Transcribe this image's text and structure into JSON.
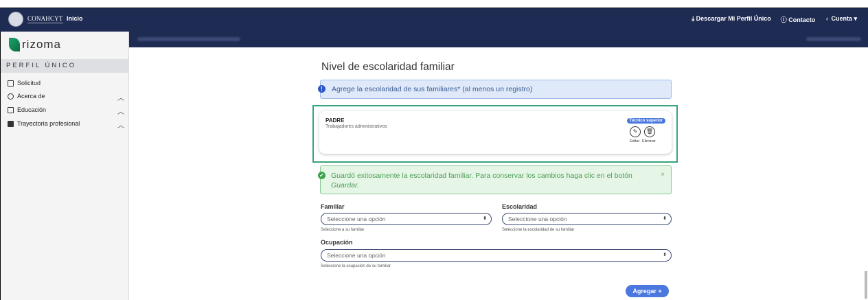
{
  "topbar": {
    "brand": "CONAHCYT",
    "inicio": "Inicio",
    "download": "⤓ Descargar Mi Perfil Único",
    "contact": "ⓘ Contacto",
    "account": "♁ Cuenta ▾"
  },
  "sidebar": {
    "logo_text": "rizoma",
    "section_title": "PERFIL ÚNICO",
    "items": [
      {
        "label": "Solicitud",
        "chevron": ""
      },
      {
        "label": "Acerca de",
        "chevron": "︿"
      },
      {
        "label": "Educación",
        "chevron": "︿"
      },
      {
        "label": "Trayectoria profesional",
        "chevron": "︿"
      }
    ]
  },
  "main": {
    "title": "Nivel de escolaridad familiar",
    "info_icon": "!",
    "info_text": "Agrege la escolaridad de sus familiares* (al menos un registro)",
    "card": {
      "relation": "PADRE",
      "occupation": "Trabajadores administrativos",
      "badge": "Técnico superior",
      "edit_icon": "✎",
      "delete_icon": "🗑",
      "edit_label": "Editar",
      "delete_label": "Eliminar"
    },
    "success": {
      "icon": "✔",
      "text": "Guardó exitosamente la escolaridad familiar. Para conservar los cambios haga clic en el botón",
      "emph": "Guardar.",
      "close": "×"
    },
    "form": {
      "familiar_label": "Familiar",
      "familiar_value": "Seleccione una opción",
      "familiar_help": "Seleccione a su familiar",
      "escolaridad_label": "Escolaridad",
      "escolaridad_value": "Seleccione una opción",
      "escolaridad_help": "Seleccione la escolaridad de su familiar",
      "ocupacion_label": "Ocupación",
      "ocupacion_value": "Seleccione una opción",
      "ocupacion_help": "Seleccione la ocupación de su familiar",
      "select_arrow": "⬍"
    },
    "add_button": "Agregar +"
  },
  "colors": {
    "navy": "#1e2b52",
    "accent": "#4a78de",
    "success": "#3da34a",
    "highlight": "#38a37d"
  }
}
